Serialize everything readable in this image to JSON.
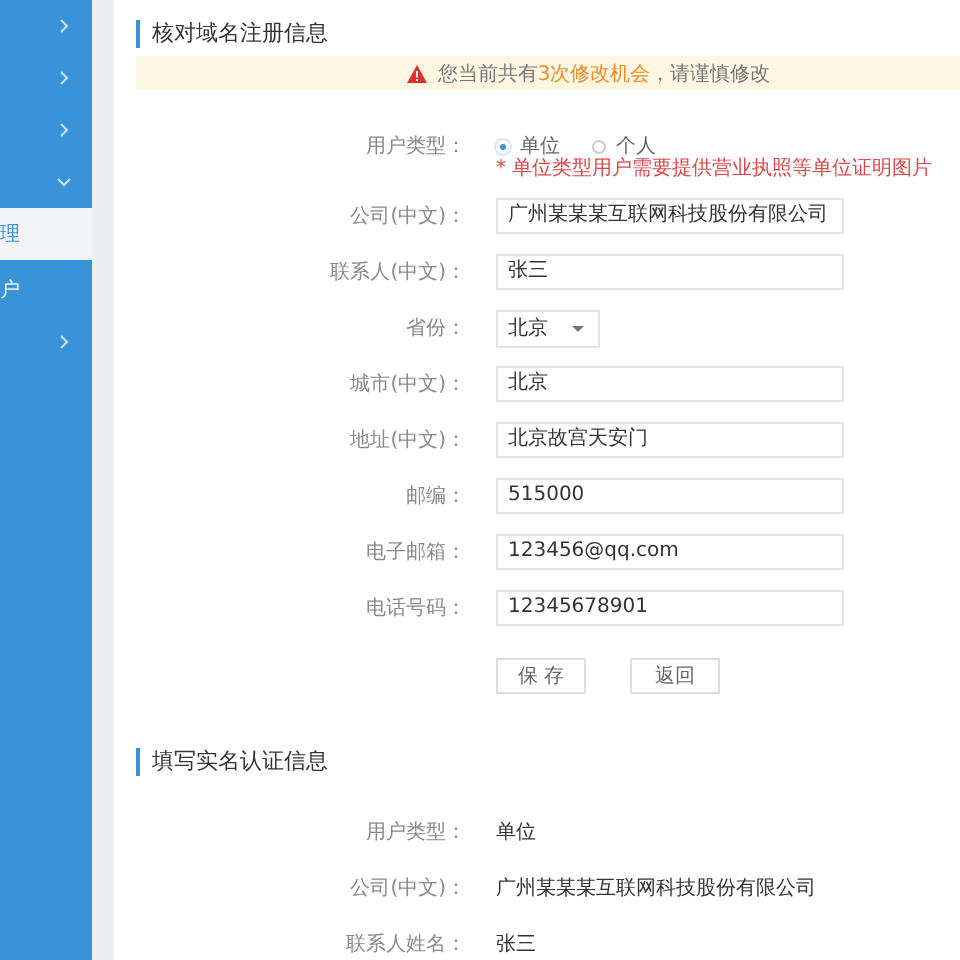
{
  "sidebar": {
    "items": [
      {
        "kind": "group",
        "expanded": false
      },
      {
        "kind": "group",
        "expanded": false
      },
      {
        "kind": "group",
        "expanded": false
      },
      {
        "kind": "group",
        "expanded": true
      },
      {
        "kind": "link",
        "label": "理",
        "selected": true
      },
      {
        "kind": "link",
        "label": "户",
        "selected": false
      },
      {
        "kind": "group",
        "expanded": false
      }
    ]
  },
  "verify_section": {
    "title": "核对域名注册信息",
    "warning": {
      "before": "您当前共有",
      "highlight": "3次修改机会",
      "after": "，请谨慎修改"
    },
    "fields": [
      {
        "kind": "radio",
        "label": "用户类型：",
        "options": [
          {
            "label": "单位",
            "selected": true
          },
          {
            "label": "个人",
            "selected": false
          }
        ]
      },
      {
        "kind": "note",
        "text": "* 单位类型用户需要提供营业执照等单位证明图片"
      },
      {
        "kind": "text",
        "label": "公司(中文)：",
        "value": "广州某某某互联网科技股份有限公司"
      },
      {
        "kind": "text",
        "label": "联系人(中文)：",
        "value": "张三"
      },
      {
        "kind": "select",
        "label": "省份：",
        "value": "北京"
      },
      {
        "kind": "text",
        "label": "城市(中文)：",
        "value": "北京"
      },
      {
        "kind": "text",
        "label": "地址(中文)：",
        "value": "北京故宫天安门"
      },
      {
        "kind": "text",
        "label": "邮编：",
        "value": "515000"
      },
      {
        "kind": "text",
        "label": "电子邮箱：",
        "value": "123456@qq.com"
      },
      {
        "kind": "text",
        "label": "电话号码：",
        "value": "12345678901"
      }
    ],
    "buttons": [
      "保 存",
      "返回"
    ]
  },
  "realname_section": {
    "title": "填写实名认证信息",
    "rows": [
      {
        "label": "用户类型：",
        "value": "单位"
      },
      {
        "label": "公司(中文)：",
        "value": "广州某某某互联网科技股份有限公司"
      },
      {
        "label": "联系人姓名：",
        "value": "张三"
      }
    ]
  }
}
